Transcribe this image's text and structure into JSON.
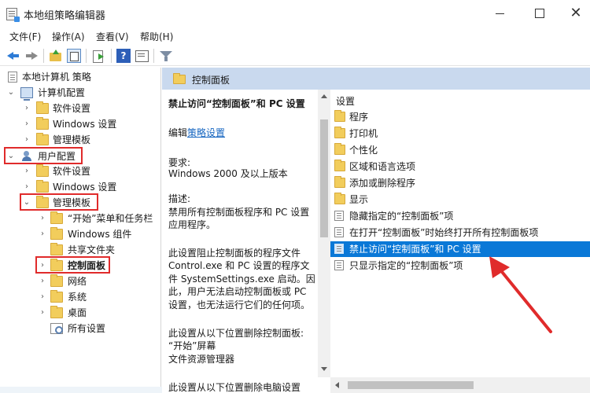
{
  "window": {
    "title": "本地组策略编辑器",
    "minimize_label": "—",
    "maximize_label": "☐",
    "close_label": "✕"
  },
  "menu": [
    "文件(F)",
    "操作(A)",
    "查看(V)",
    "帮助(H)"
  ],
  "toolbar": {
    "icons": [
      "back-arrow-icon",
      "forward-arrow-icon",
      "up-folder-icon",
      "show-tree-icon",
      "export-list-icon",
      "help-icon",
      "properties-icon",
      "filter-icon"
    ],
    "help_glyph": "?"
  },
  "tree": {
    "root": "本地计算机 策略",
    "computer_config": "计算机配置",
    "computer_children": [
      "软件设置",
      "Windows 设置",
      "管理模板"
    ],
    "user_config": "用户配置",
    "user_children": [
      "软件设置",
      "Windows 设置",
      "管理模板"
    ],
    "admin_template_children": [
      "“开始”菜单和任务栏",
      "Windows 组件",
      "共享文件夹",
      "控制面板",
      "网络",
      "系统",
      "桌面",
      "所有设置"
    ]
  },
  "header": {
    "title": "控制面板"
  },
  "description": {
    "title": "禁止访问“控制面板”和 PC 设置",
    "edit_prefix": "编辑",
    "edit_link": "策略设置",
    "req_label": "要求:",
    "req_value": "Windows 2000 及以上版本",
    "desc_label": "描述:",
    "desc_lines": [
      "禁用所有控制面板程序和 PC 设置",
      "应用程序。"
    ],
    "para_lines": [
      "此设置阻止控制面板的程序文件",
      "Control.exe 和 PC 设置的程序文",
      "件 SystemSettings.exe 启动。因",
      "此，用户无法启动控制面板或 PC",
      "设置，也无法运行它们的任何项。"
    ],
    "remove_lines": [
      "此设置从以下位置删除控制面板:",
      "“开始”屏幕",
      "文件资源管理器"
    ],
    "cut_line": "此设置从以下位置删除电脑设置"
  },
  "list": {
    "header": "设置",
    "items": [
      {
        "label": "程序",
        "type": "folder"
      },
      {
        "label": "打印机",
        "type": "folder"
      },
      {
        "label": "个性化",
        "type": "folder"
      },
      {
        "label": "区域和语言选项",
        "type": "folder"
      },
      {
        "label": "添加或删除程序",
        "type": "folder"
      },
      {
        "label": "显示",
        "type": "folder"
      },
      {
        "label": "隐藏指定的“控制面板”项",
        "type": "policy"
      },
      {
        "label": "在打开“控制面板”时始终打开所有控制面板项",
        "type": "policy"
      },
      {
        "label": "禁止访问“控制面板”和 PC 设置",
        "type": "policy",
        "selected": true
      },
      {
        "label": "只显示指定的“控制面板”项",
        "type": "policy"
      }
    ]
  },
  "colors": {
    "selection": "#0a78d7",
    "header_bg": "#c9d9ee",
    "highlight_box": "#e02b2b",
    "link": "#1565c0"
  }
}
